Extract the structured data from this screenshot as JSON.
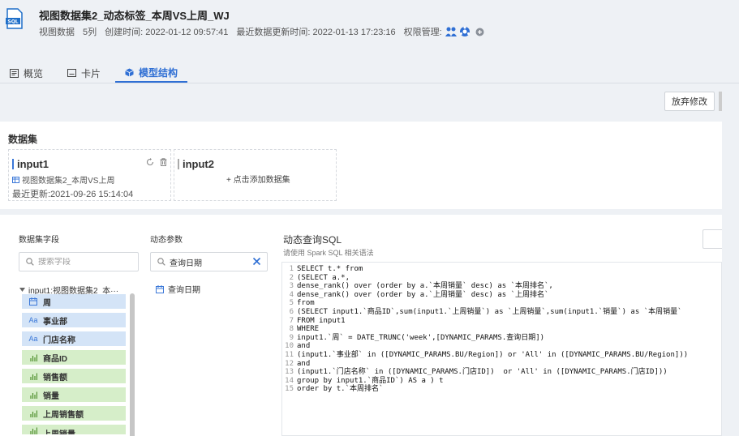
{
  "header": {
    "title": "视图数据集2_动态标签_本周VS上周_WJ",
    "meta": {
      "type": "视图数据",
      "columns": "5列",
      "created": "创建时间: 2022-01-12 09:57:41",
      "updated": "最近数据更新时间: 2022-01-13 17:23:16",
      "permission": "权限管理:"
    },
    "icon_text": "SQL"
  },
  "tabs": [
    {
      "label": "概览",
      "icon": "overview-icon",
      "active": false
    },
    {
      "label": "卡片",
      "icon": "card-icon",
      "active": false
    },
    {
      "label": "模型结构",
      "icon": "model-icon",
      "active": true
    }
  ],
  "toolbar": {
    "discard_label": "放弃修改"
  },
  "dataset": {
    "title": "数据集",
    "cards": [
      {
        "name": "input1",
        "source": "视图数据集2_本周VS上周",
        "updated": "最近更新:2021-09-26 15:14:04"
      },
      {
        "name": "input2",
        "add_label": "+ 点击添加数据集"
      }
    ]
  },
  "fields": {
    "title": "数据集字段",
    "search_placeholder": "搜索字段",
    "tree_node": "input1:视图数据集2_本···",
    "items": [
      {
        "type_label": "",
        "name": "周",
        "kind": "date"
      },
      {
        "type_label": "Aa",
        "name": "事业部",
        "kind": "text"
      },
      {
        "type_label": "Aa",
        "name": "门店名称",
        "kind": "text"
      },
      {
        "type_label": "",
        "name": "商品ID",
        "kind": "measure"
      },
      {
        "type_label": "",
        "name": "销售额",
        "kind": "measure"
      },
      {
        "type_label": "",
        "name": "销量",
        "kind": "measure"
      },
      {
        "type_label": "",
        "name": "上周销售额",
        "kind": "measure"
      },
      {
        "type_label": "",
        "name": "上周销量",
        "kind": "measure"
      }
    ]
  },
  "params": {
    "title": "动态参数",
    "search_value": "查询日期",
    "items": [
      {
        "name": "查询日期"
      }
    ]
  },
  "sql": {
    "title": "动态查询SQL",
    "subtitle": "请使用 Spark SQL 相关语法",
    "lines": [
      "SELECT t.* from",
      "(SELECT a.*,",
      "dense_rank() over (order by a.`本周销量` desc) as `本周排名`,",
      "dense_rank() over (order by a.`上周销量` desc) as `上周排名`",
      "from",
      "(SELECT input1.`商品ID`,sum(input1.`上周销量`) as `上周销量`,sum(input1.`销量`) as `本周销量`",
      "FROM input1",
      "WHERE",
      "input1.`周` = DATE_TRUNC('week',[DYNAMIC_PARAMS.查询日期])",
      "and",
      "(input1.`事业部` in ([DYNAMIC_PARAMS.BU/Region]) or 'All' in ([DYNAMIC_PARAMS.BU/Region]))",
      "and",
      "(input1.`门店名称` in ([DYNAMIC_PARAMS.门店ID])  or 'All' in ([DYNAMIC_PARAMS.门店ID]))",
      "group by input1.`商品ID`) AS a ) t",
      "order by t.`本周排名`"
    ]
  }
}
